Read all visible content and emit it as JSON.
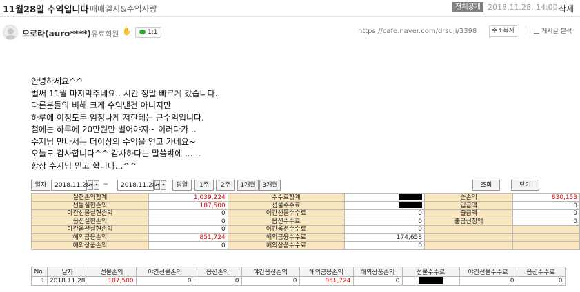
{
  "header": {
    "title": "11월28일 수익입니다",
    "separator": "|",
    "category": "매매일지&수익자랑",
    "visibility_badge": "전체공개",
    "date": "2018.11.28. 14:00",
    "delete_label": "삭제"
  },
  "author": {
    "name": "오로라(auro****)",
    "level": "유료회원",
    "chat_label": "1:1",
    "url": "https://cafe.naver.com/drsuji/3398",
    "copy_address_label": "주소복사",
    "post_analysis_label": "게시글 분석"
  },
  "post": {
    "lines": [
      "안녕하세요^^",
      "벌써 11월 마지막주네요.. 시간 정말 빠르게 갔습니다..",
      "다른분들의 비해 크게 수익낸건 아니지만",
      "하루에 이정도두 엄청나게 저한테는 큰수익입니다.",
      "첨에는 하루에 20만원만 벌어야지~ 이러다가 ..",
      "수지님 만나서는 더이상의 수익을 얻고 가네요~",
      "오늘도 감사합니다^^  감사하다는 말씀밖에 ......",
      "항상 수지님 믿고 합니다...^^"
    ]
  },
  "toolbar": {
    "date_label": "일자",
    "start_date": "2018.11.28",
    "tilde": "~",
    "end_date": "2018.11.28",
    "day_btn": "당일",
    "week1_btn": "1주",
    "week2_btn": "2주",
    "month1_btn": "1개월",
    "month3_btn": "3개월",
    "query_btn": "조회",
    "close_btn": "닫기"
  },
  "summary": {
    "rows": [
      {
        "l1": "실현손익합계",
        "v1": "1,039,224",
        "l2": "수수료합계",
        "v2": "",
        "l3": "순손익",
        "v3": "830,153"
      },
      {
        "l1": "선물실현손익",
        "v1": "187,500",
        "l2": "선물수수료",
        "v2": "",
        "l3": "입금액",
        "v3": "0"
      },
      {
        "l1": "야간선물실현손익",
        "v1": "0",
        "l2": "야간선물수수료",
        "v2": "0",
        "l3": "출금액",
        "v3": "0"
      },
      {
        "l1": "옵션실현손익",
        "v1": "0",
        "l2": "옵션수수료",
        "v2": "0",
        "l3": "출금신청액",
        "v3": "0"
      },
      {
        "l1": "야간옵션실현손익",
        "v1": "0",
        "l2": "야간옵션수수료",
        "v2": "0",
        "l3": "",
        "v3": ""
      },
      {
        "l1": "해외금융손익",
        "v1": "851,724",
        "l2": "해외금융수수료",
        "v2": "174,658",
        "l3": "",
        "v3": ""
      },
      {
        "l1": "해외상품손익",
        "v1": "0",
        "l2": "해외상품수수료",
        "v2": "0",
        "l3": "",
        "v3": ""
      }
    ]
  },
  "daily": {
    "headers": [
      "No.",
      "날자",
      "선물손익",
      "야간선물손익",
      "옵션손익",
      "야간옵션손익",
      "해외금융손익",
      "해외상품손익",
      "선물수수료",
      "야간선물수수료",
      "옵션수수료"
    ],
    "rows": [
      [
        "1",
        "2018.11.28",
        "187,500",
        "0",
        "0",
        "0",
        "851,724",
        "0",
        "",
        "0",
        "0"
      ]
    ]
  },
  "colors": {
    "label_bg": "#fbe7bf",
    "profit_red": "#e10000",
    "chat_green": "#2eb12e"
  }
}
